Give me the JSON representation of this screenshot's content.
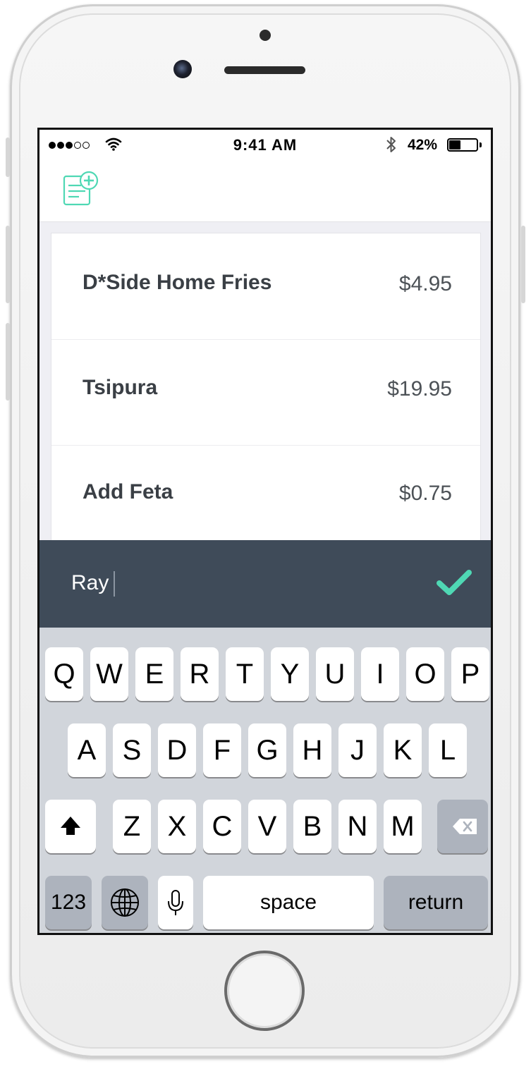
{
  "status_bar": {
    "time": "9:41 AM",
    "battery_percent_label": "42%",
    "battery_level": 0.42,
    "signal_bars_filled": 3,
    "signal_bars_total": 5,
    "icons": [
      "signal-dots-icon",
      "wifi-icon",
      "bluetooth-icon",
      "battery-icon"
    ]
  },
  "nav": {
    "icon": "new-receipt-plus-icon"
  },
  "items": [
    {
      "name": "D*Side Home Fries",
      "price": "$4.95"
    },
    {
      "name": "Tsipura",
      "price": "$19.95"
    },
    {
      "name": "Add Feta",
      "price": "$0.75"
    }
  ],
  "input": {
    "value": "Ray",
    "confirm_icon": "checkmark-icon"
  },
  "keyboard": {
    "row1": [
      "Q",
      "W",
      "E",
      "R",
      "T",
      "Y",
      "U",
      "I",
      "O",
      "P"
    ],
    "row2": [
      "A",
      "S",
      "D",
      "F",
      "G",
      "H",
      "J",
      "K",
      "L"
    ],
    "row3": [
      "Z",
      "X",
      "C",
      "V",
      "B",
      "N",
      "M"
    ],
    "shift_icon": "shift-arrow-icon",
    "delete_icon": "backspace-icon",
    "numbers_label": "123",
    "globe_icon": "globe-icon",
    "mic_icon": "microphone-icon",
    "space_label": "space",
    "return_label": "return"
  },
  "colors": {
    "accent": "#4fd8b4",
    "input_bar": "#3f4b59",
    "keyboard_bg": "#d1d5db",
    "item_text": "#3a3f45"
  }
}
